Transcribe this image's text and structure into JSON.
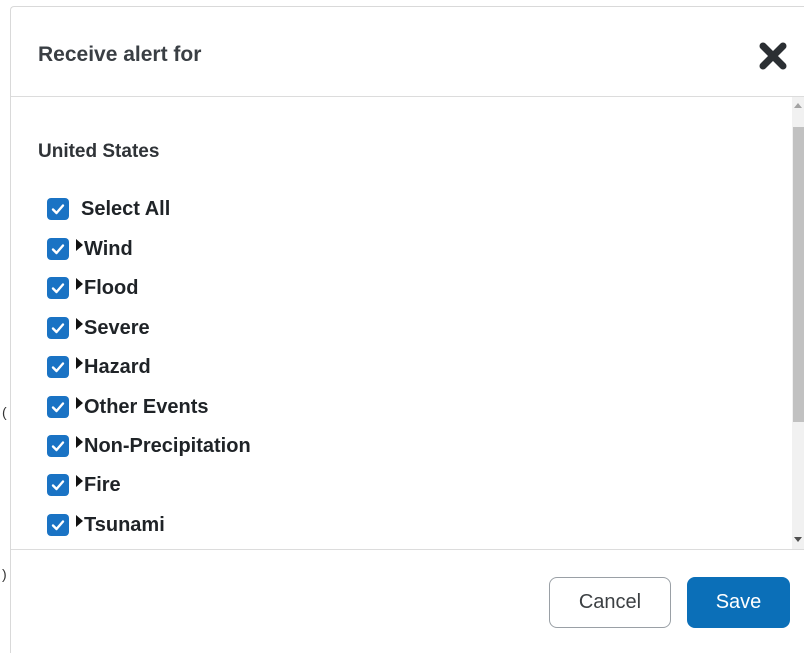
{
  "dialog": {
    "title": "Receive alert for",
    "close_icon": "close-x-icon"
  },
  "section": {
    "title": "United States"
  },
  "options": [
    {
      "label": "Select All",
      "checked": true,
      "expandable": false
    },
    {
      "label": "Wind",
      "checked": true,
      "expandable": true
    },
    {
      "label": "Flood",
      "checked": true,
      "expandable": true
    },
    {
      "label": "Severe",
      "checked": true,
      "expandable": true
    },
    {
      "label": "Hazard",
      "checked": true,
      "expandable": true
    },
    {
      "label": "Other Events",
      "checked": true,
      "expandable": true
    },
    {
      "label": "Non-Precipitation",
      "checked": true,
      "expandable": true
    },
    {
      "label": "Fire",
      "checked": true,
      "expandable": true
    },
    {
      "label": "Tsunami",
      "checked": true,
      "expandable": true
    }
  ],
  "footer": {
    "cancel_label": "Cancel",
    "save_label": "Save"
  },
  "colors": {
    "checkbox": "#1a73c4",
    "save_button": "#0b6fb8"
  }
}
